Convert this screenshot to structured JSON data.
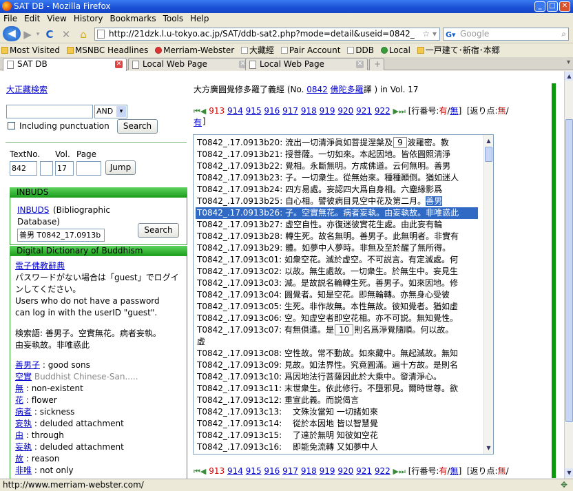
{
  "window": {
    "title": "SAT DB - Mozilla Firefox"
  },
  "menu": [
    "File",
    "Edit",
    "View",
    "History",
    "Bookmarks",
    "Tools",
    "Help"
  ],
  "nav": {
    "url": "http://21dzk.l.u-tokyo.ac.jp/SAT/ddb-sat2.php?mode=detail&useid=0842_",
    "search_placeholder": "Google"
  },
  "bookmarks": [
    {
      "label": "Most Visited",
      "icon": "folder-icon"
    },
    {
      "label": "MSNBC Headlines",
      "icon": "folder-icon"
    },
    {
      "label": "Merriam-Webster",
      "icon": "mw-icon"
    },
    {
      "label": "大藏經",
      "icon": "page-icon"
    },
    {
      "label": "Pair Account",
      "icon": "page-icon"
    },
    {
      "label": "DDB",
      "icon": "page-icon"
    },
    {
      "label": "Local",
      "icon": "leaf-icon"
    },
    {
      "label": "一戸建て･新宿･本郷",
      "icon": "folder-icon"
    }
  ],
  "tabs": [
    {
      "label": "SAT DB",
      "active": true
    },
    {
      "label": "Local Web Page",
      "active": false
    },
    {
      "label": "Local Web Page",
      "active": false
    }
  ],
  "left": {
    "taisho_link": "大正藏検索",
    "search_value": "",
    "and_option": "AND",
    "punct_label": "Including punctuation",
    "search_btn": "Search",
    "textno_label": "TextNo.",
    "vol_label": "Vol.",
    "page_label": "Page",
    "textno_value": "842",
    "vol_value": "17",
    "jump_btn": "Jump",
    "inbuds_header": "INBUDS",
    "inbuds_link": "INBUDS",
    "inbuds_desc_1": "(Bibliographic",
    "inbuds_desc_2": "Database)",
    "inbuds_input": "善男 T0842_17.0913b",
    "inbuds_btn": "Search",
    "ddb_header": "Digital Dictionary of Buddhism",
    "ddb_link": "電子佛教辭典",
    "ddb_jp_1": "パスワードがない場合は「guest」でログイ",
    "ddb_jp_2": "ンしてください。",
    "ddb_en_1": "Users who do not have a password",
    "ddb_en_2": "can log in with the userID \"guest\".",
    "query_1": "検索語: 善男子。空實無花。病者妄執。",
    "query_2": "由妄執故。非唯惑此",
    "entries": [
      {
        "term": "善男子",
        "def": ": good sons"
      },
      {
        "term": "空實",
        "def": "Buddhist Chinese-San....."
      },
      {
        "term": "無",
        "def": ": non-existent"
      },
      {
        "term": "花",
        "def": ": flower"
      },
      {
        "term": "病者",
        "def": ": sickness"
      },
      {
        "term": "妄執",
        "def": ": deluded attachment"
      },
      {
        "term": "由",
        "def": ": through"
      },
      {
        "term": "妄執",
        "def": ": deluded attachment"
      },
      {
        "term": "故",
        "def": ": reason"
      },
      {
        "term": "非唯",
        "def": ": not only"
      }
    ]
  },
  "right": {
    "title_pre": "大方廣圓覺修多羅了義經 (No. ",
    "title_no": "0842",
    "title_trans": "佛陀多羅",
    "title_post": "譯 ) in Vol. 17",
    "pages_current": "913",
    "pages": [
      "914",
      "915",
      "916",
      "917",
      "918",
      "919",
      "920",
      "921",
      "922"
    ],
    "lineno_label": "[行番号:",
    "lineno_on": "有",
    "lineno_off": "無",
    "kaeri_label": "[返り点:",
    "kaeri_off": "無",
    "kaeri_on": "有",
    "lines": [
      {
        "id": "T0842_.17.0913b20:",
        "text": "流出一切清淨眞如菩提涅槃及",
        "box": "9",
        "after": "波羅密。教"
      },
      {
        "id": "T0842_.17.0913b21:",
        "text": "授菩薩。一切如來。本起因地。皆依圓照淸淨"
      },
      {
        "id": "T0842_.17.0913b22:",
        "text": "覺相。永斷無明。方成佛道。云何無明。善男"
      },
      {
        "id": "T0842_.17.0913b23:",
        "text": "子。一切衆生。從無始來。種種顚倒。猶如迷人"
      },
      {
        "id": "T0842_.17.0913b24:",
        "text": "四方易處。妄認四大爲自身相。六塵緣影爲"
      },
      {
        "id": "T0842_.17.0913b25:",
        "text": "自心相。譬彼病目見空中花及第二月。",
        "hl": "善男"
      },
      {
        "id": "T0842_.17.0913b26:",
        "text": "子。空實無花。病者妄執。由妄執故。非唯惑此",
        "sel": true
      },
      {
        "id": "T0842_.17.0913b27:",
        "text": "虚空自性。亦復迷彼實花生處。由此妄有輪"
      },
      {
        "id": "T0842_.17.0913b28:",
        "text": "轉生死。故名無明。善男子。此無明者。非實有"
      },
      {
        "id": "T0842_.17.0913b29:",
        "text": "體。如夢中人夢時。非無及至於醒了無所得。"
      },
      {
        "id": "T0842_.17.0913c01:",
        "text": "如衆空花。滅於虚空。不可説言。有定滅處。何"
      },
      {
        "id": "T0842_.17.0913c02:",
        "text": "以故。無生處故。一切衆生。於無生中。妄見生"
      },
      {
        "id": "T0842_.17.0913c03:",
        "text": "滅。是故説名輪轉生死。善男子。如來因地。修"
      },
      {
        "id": "T0842_.17.0913c04:",
        "text": "圓覺者。知是空花。即無輪轉。亦無身心受彼"
      },
      {
        "id": "T0842_.17.0913c05:",
        "text": "生死。非作故無。本性無故。彼知覺者。猶如虚"
      },
      {
        "id": "T0842_.17.0913c06:",
        "text": "空。知虚空者即空花相。亦不可説。無知覺性。"
      },
      {
        "id": "T0842_.17.0913c07:",
        "text": "有無俱遣。是",
        "box": "10",
        "after": "則名爲淨覺隨順。何以故。"
      },
      {
        "id": "",
        "text": "虚"
      },
      {
        "id": "T0842_.17.0913c08:",
        "text": "空性故。常不動故。如來藏中。無起滅故。無知"
      },
      {
        "id": "T0842_.17.0913c09:",
        "text": "見故。如法界性。究竟圓滿。遍十方故。是則名"
      },
      {
        "id": "T0842_.17.0913c10:",
        "text": "爲因地法行菩薩因此於大乘中。發清淨心。"
      },
      {
        "id": "T0842_.17.0913c11:",
        "text": "末世衆生。依此修行。不墮邪見。爾時世尊。欲"
      },
      {
        "id": "T0842_.17.0913c12:",
        "text": "重宣此義。而説偈言"
      },
      {
        "id": "T0842_.17.0913c13:",
        "text": "　文殊汝當知 一切諸如來"
      },
      {
        "id": "T0842_.17.0913c14:",
        "text": "　從於本因地 皆以智慧覺"
      },
      {
        "id": "T0842_.17.0913c15:",
        "text": "　了達於無明 知彼如空花"
      },
      {
        "id": "T0842_.17.0913c16:",
        "text": "　即能免流轉 又如夢中人"
      }
    ]
  },
  "status": {
    "text": "http://www.merriam-webster.com/"
  }
}
